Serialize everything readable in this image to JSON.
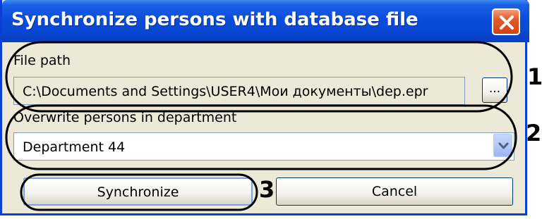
{
  "window": {
    "title": "Synchronize persons with database file"
  },
  "file_path": {
    "label": "File path",
    "value": "C:\\Documents and Settings\\USER4\\Мои документы\\dep.epr",
    "browse_label": "..."
  },
  "department": {
    "label": "Overwrite persons in department",
    "selected": "Department 44"
  },
  "buttons": {
    "synchronize": "Synchronize",
    "cancel": "Cancel"
  },
  "annotations": {
    "marker_1": "1",
    "marker_2": "2",
    "marker_3": "3"
  },
  "colors": {
    "titlebar": "#0a4ddb",
    "window_bg": "#ece9d8",
    "close_button": "#e2592c"
  }
}
